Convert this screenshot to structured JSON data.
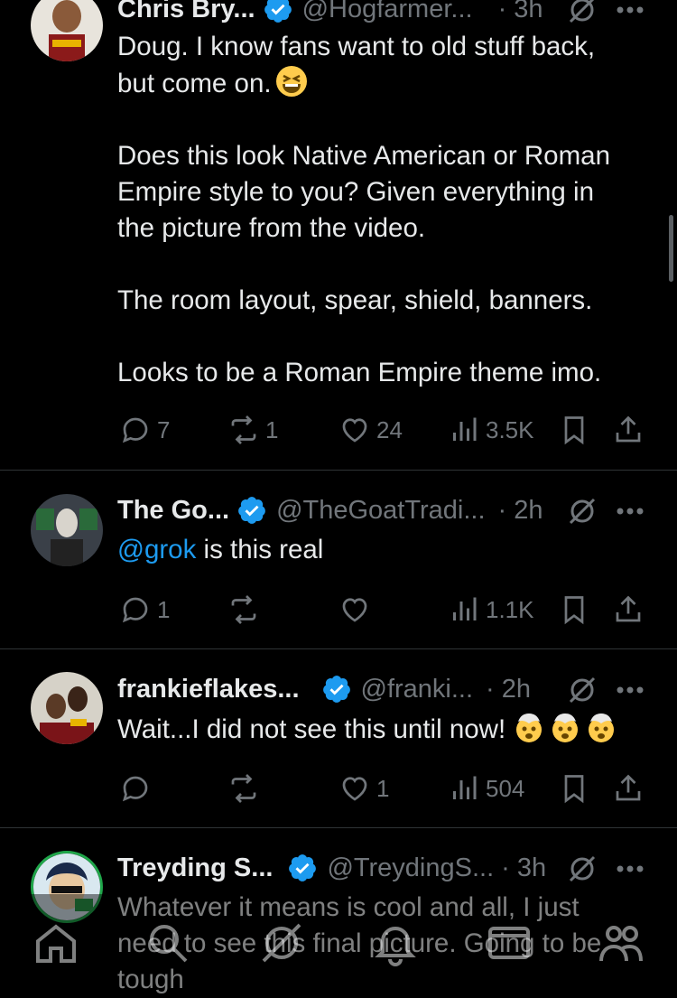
{
  "tweets": [
    {
      "name": "Chris Bry...",
      "handle": "@Hogfarmer...",
      "time": "· 3h",
      "body": [
        "Doug. I know fans want to old stuff back,",
        "but come on."
      ],
      "body2": [
        "Does this look Native American or Roman",
        "Empire style to you? Given everything in",
        "the picture from the video."
      ],
      "body3": [
        "The room layout, spear, shield, banners."
      ],
      "body4": [
        "Looks to be a Roman Empire theme imo."
      ],
      "replies": "7",
      "reposts": "1",
      "likes": "24",
      "views": "3.5K"
    },
    {
      "name": "The Go...",
      "handle": "@TheGoatTradi...",
      "time": "· 2h",
      "mention": "@grok",
      "body": " is this real",
      "replies": "1",
      "reposts": "",
      "likes": "",
      "views": "1.1K"
    },
    {
      "name": "frankieflakes...",
      "handle": "@franki...",
      "time": "· 2h",
      "body": "Wait...I did not see this until now!",
      "replies": "",
      "reposts": "",
      "likes": "1",
      "views": "504"
    },
    {
      "name": "Treyding S...",
      "handle": "@TreydingS...",
      "time": "· 3h",
      "body": [
        "Whatever it means is cool and all, I just",
        "need to see this final picture. Going to be",
        "tough"
      ]
    }
  ],
  "icons": {
    "verified_color": "#1d9bf0",
    "muted": "#71767b",
    "text": "#e7e9ea",
    "accent": "#1d9bf0"
  },
  "tabbar": [
    "home-icon",
    "search-icon",
    "grok-icon",
    "notifications-icon",
    "messages-icon",
    "communities-icon"
  ]
}
